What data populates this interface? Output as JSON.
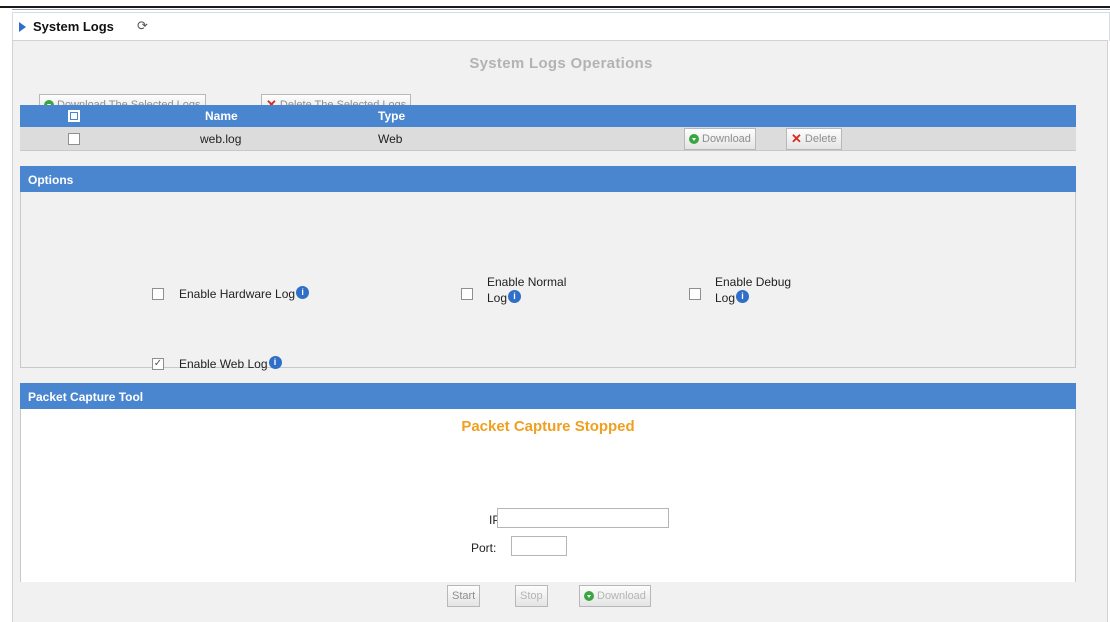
{
  "header": {
    "title": "System Logs",
    "refresh_icon": "refresh-icon"
  },
  "operations": {
    "heading": "System Logs Operations",
    "download_selected_label": "Download The Selected Logs",
    "delete_selected_label": "Delete The Selected Logs"
  },
  "logs_table": {
    "columns": [
      "Name",
      "Type"
    ],
    "rows": [
      {
        "name": "web.log",
        "type": "Web",
        "download_label": "Download",
        "delete_label": "Delete",
        "checked": false
      }
    ]
  },
  "options": {
    "heading": "Options",
    "items": [
      {
        "label_line1": "Enable Hardware Log",
        "label_line2": "",
        "checked": false
      },
      {
        "label_line1": "Enable Normal",
        "label_line2": "Log",
        "checked": false
      },
      {
        "label_line1": "Enable Debug",
        "label_line2": "Log",
        "checked": false
      },
      {
        "label_line1": "Enable Web Log",
        "label_line2": "",
        "checked": true
      }
    ]
  },
  "packet_capture": {
    "heading": "Packet Capture Tool",
    "status": "Packet Capture Stopped",
    "ip_label": "IP:",
    "ip_value": "",
    "port_label": "Port:",
    "port_value": "",
    "start_label": "Start",
    "stop_label": "Stop",
    "download_label": "Download"
  },
  "colors": {
    "accent": "#4a86d0",
    "status": "#f0a020",
    "info": "#2f6fc7"
  }
}
